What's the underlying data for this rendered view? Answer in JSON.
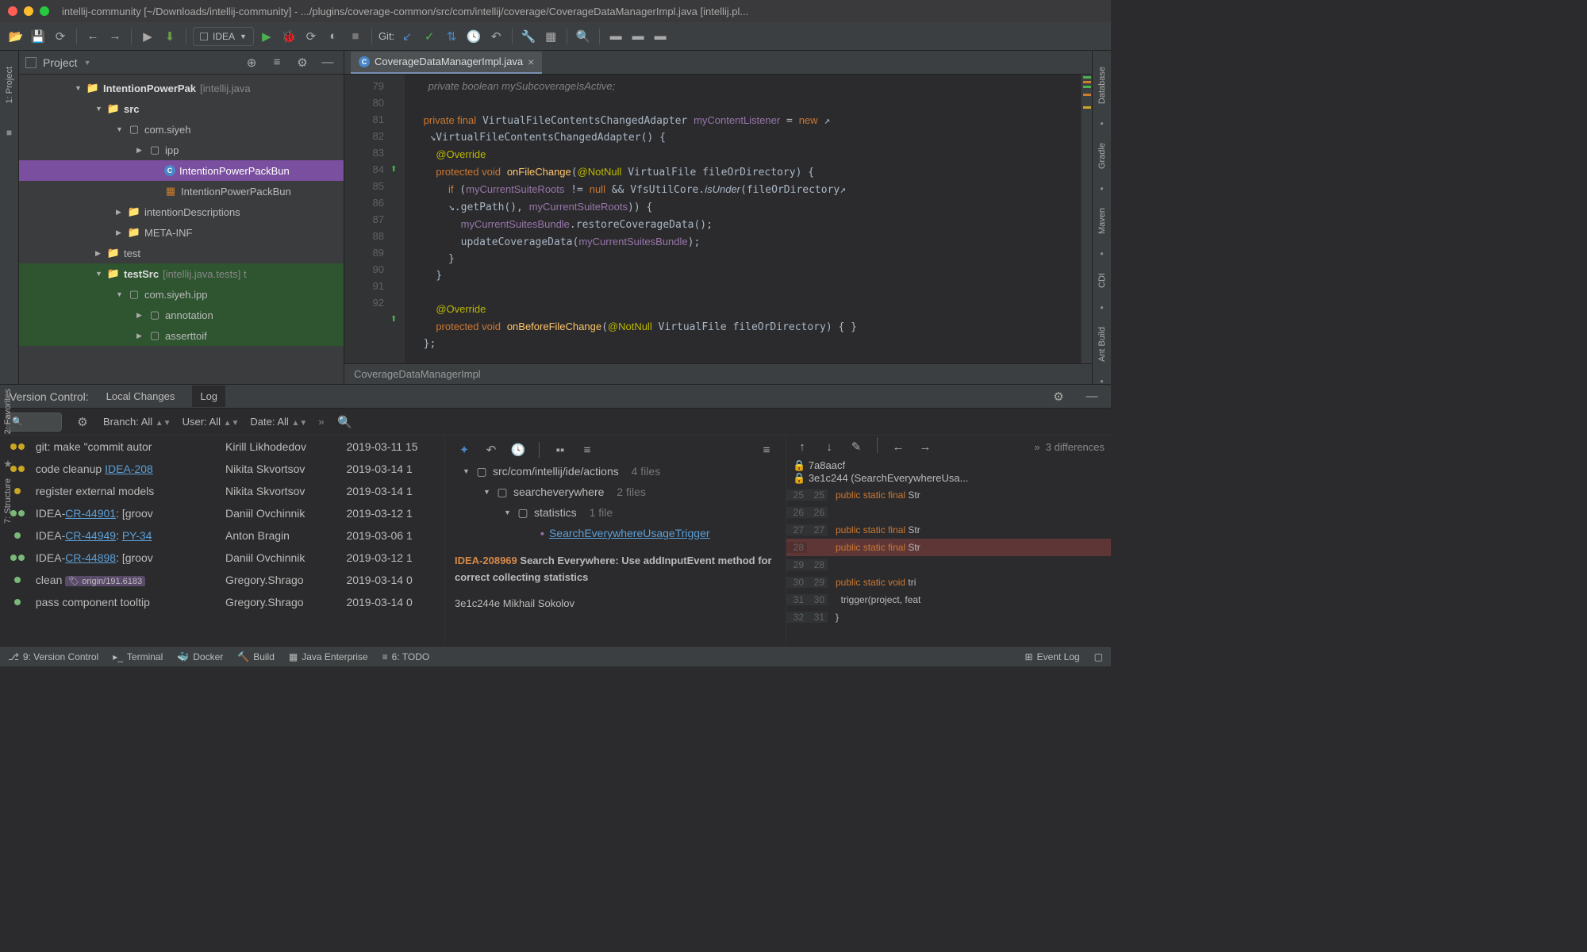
{
  "window": {
    "title": "intellij-community [~/Downloads/intellij-community] - .../plugins/coverage-common/src/com/intellij/coverage/CoverageDataManagerImpl.java [intellij.pl..."
  },
  "toolbar": {
    "run_config": "IDEA",
    "git_label": "Git:"
  },
  "project": {
    "header": "Project",
    "items": [
      {
        "indent": 70,
        "arrow": "▼",
        "icon": "folder",
        "label": "IntentionPowerPak",
        "suffix": " [intellij.java",
        "bold": true
      },
      {
        "indent": 96,
        "arrow": "▼",
        "icon": "folder-src",
        "label": "src",
        "bold": true
      },
      {
        "indent": 122,
        "arrow": "▼",
        "icon": "pkg",
        "label": "com.siyeh"
      },
      {
        "indent": 148,
        "arrow": "▶",
        "icon": "pkg",
        "label": "ipp"
      },
      {
        "indent": 168,
        "arrow": "",
        "icon": "class",
        "label": "IntentionPowerPackBun",
        "selected": true
      },
      {
        "indent": 168,
        "arrow": "",
        "icon": "bundle",
        "label": "IntentionPowerPackBun"
      },
      {
        "indent": 122,
        "arrow": "▶",
        "icon": "folder",
        "label": "intentionDescriptions"
      },
      {
        "indent": 122,
        "arrow": "▶",
        "icon": "folder",
        "label": "META-INF"
      },
      {
        "indent": 96,
        "arrow": "▶",
        "icon": "folder",
        "label": "test"
      },
      {
        "indent": 96,
        "arrow": "▼",
        "icon": "folder-green",
        "label": "testSrc",
        "suffix": " [intellij.java.tests]  t",
        "bold": true,
        "green": true
      },
      {
        "indent": 122,
        "arrow": "▼",
        "icon": "pkg",
        "label": "com.siyeh.ipp",
        "green": true
      },
      {
        "indent": 148,
        "arrow": "▶",
        "icon": "pkg",
        "label": "annotation",
        "green": true
      },
      {
        "indent": 148,
        "arrow": "▶",
        "icon": "pkg",
        "label": "asserttoif",
        "green": true
      }
    ]
  },
  "editor": {
    "tab_name": "CoverageDataManagerImpl.java",
    "breadcrumb": "CoverageDataManagerImpl",
    "line_start": 79,
    "lines": [
      "",
      "79",
      "80",
      "",
      "81",
      "82",
      "83",
      "",
      "84",
      "85",
      "86",
      "87",
      "88",
      "89",
      "90",
      "91",
      "92"
    ]
  },
  "vcs": {
    "title": "Version Control:",
    "tabs": [
      "Local Changes",
      "Log"
    ],
    "active_tab": "Log",
    "filters": {
      "branch": "Branch: All",
      "user": "User: All",
      "date": "Date: All"
    },
    "commits": [
      {
        "msg_pre": "git: make \"commit autor",
        "author": "Kirill Likhodedov",
        "date": "2019-03-11 15",
        "dots": [
          "#c9a623",
          "#c9a623"
        ]
      },
      {
        "msg_pre": "code cleanup ",
        "link": "IDEA-208",
        "author": "Nikita Skvortsov",
        "date": "2019-03-14 1",
        "dots": [
          "#c9a623",
          "#c9a623"
        ]
      },
      {
        "msg_pre": "register external models",
        "author": "Nikita Skvortsov",
        "date": "2019-03-14 1",
        "dots": [
          "#c9a623"
        ]
      },
      {
        "msg_pre": "IDEA-",
        "link": "CR-44901",
        "msg_post": ": [groov",
        "author": "Daniil Ovchinnik",
        "date": "2019-03-12 1",
        "dots": [
          "#7ab87a",
          "#7ab87a"
        ]
      },
      {
        "msg_pre": "IDEA-",
        "link": "CR-44949",
        "msg_mid": ": ",
        "link2": "PY-34",
        "author": "Anton Bragin",
        "date": "2019-03-06 1",
        "dots": [
          "#7ab87a"
        ]
      },
      {
        "msg_pre": "IDEA-",
        "link": "CR-44898",
        "msg_post": ": [groov",
        "author": "Daniil Ovchinnik",
        "date": "2019-03-12 1",
        "dots": [
          "#7ab87a",
          "#7ab87a"
        ]
      },
      {
        "msg_pre": "clean",
        "tag": "origin/191.6183",
        "author": "Gregory.Shrago",
        "date": "2019-03-14 0",
        "dots": [
          "#7ab87a"
        ]
      },
      {
        "msg_pre": "pass component tooltip",
        "author": "Gregory.Shrago",
        "date": "2019-03-14 0",
        "dots": [
          "#7ab87a"
        ]
      }
    ],
    "files": {
      "path1": "src/com/intellij/ide/actions",
      "count1": "4 files",
      "path2": "searcheverywhere",
      "count2": "2 files",
      "path3": "statistics",
      "count3": "1 file",
      "file": "SearchEverywhereUsageTrigger"
    },
    "detail": {
      "ticket": "IDEA-208969",
      "text": " Search Everywhere: Use addInputEvent method for correct collecting statistics",
      "hash": "3e1c244e Mikhail Sokolov"
    },
    "diff": {
      "diff_count": "3 differences",
      "hash1": "7a8aacf",
      "hash2": "3e1c244 (SearchEverywhereUsa...",
      "lines": [
        {
          "l": "25",
          "r": "25",
          "t": "public static final Str"
        },
        {
          "l": "26",
          "r": "26",
          "t": ""
        },
        {
          "l": "27",
          "r": "27",
          "t": "public static final Str"
        },
        {
          "l": "28",
          "r": "",
          "t": "public static final Str",
          "removed": true
        },
        {
          "l": "29",
          "r": "28",
          "t": ""
        },
        {
          "l": "30",
          "r": "29",
          "t": "public static void tri"
        },
        {
          "l": "31",
          "r": "30",
          "t": "  trigger(project, feat"
        },
        {
          "l": "32",
          "r": "31",
          "t": "}"
        }
      ]
    }
  },
  "bottom": {
    "vc": "9: Version Control",
    "terminal": "Terminal",
    "docker": "Docker",
    "build": "Build",
    "jee": "Java Enterprise",
    "todo": "6: TODO",
    "eventlog": "Event Log"
  },
  "right_tools": [
    "Database",
    "Gradle",
    "Maven",
    "CDI",
    "Ant Build"
  ]
}
